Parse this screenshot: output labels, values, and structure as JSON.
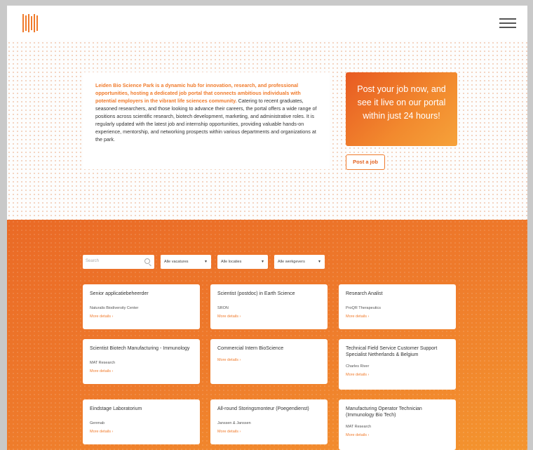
{
  "header": {
    "logo_icon": "vertical-stripes-logo-icon",
    "menu_icon": "hamburger-menu-icon"
  },
  "intro": {
    "highlight": "Leiden Bio Science Park is a dynamic hub for innovation, research, and professional opportunities, hosting a dedicated job portal that connects ambitious individuals with potential employers in the vibrant life sciences community.",
    "body": " Catering to recent graduates, seasoned researchers, and those looking to advance their careers, the portal offers a wide range of positions across scientific research, biotech development, marketing, and administrative roles. It is regularly updated with the latest job and internship opportunities, providing valuable hands-on experience, mentorship, and networking prospects within various departments and organizations at the park."
  },
  "promo": {
    "text": "Post your job now, and see it live on our portal within just 24 hours!"
  },
  "post_button": {
    "label": "Post a job"
  },
  "filters": {
    "search_placeholder": "Search",
    "search_icon": "search-icon",
    "select1": "Alle vacatures",
    "select2": "Alle locaties",
    "select3": "Alle werkgevers"
  },
  "jobs": [
    {
      "title": "Senior applicatiebeheerder",
      "company": "Naturalis Biodiversity Center",
      "more": "More details ›"
    },
    {
      "title": "Scientist (postdoc) in Earth Science",
      "company": "SRON",
      "more": "More details ›"
    },
    {
      "title": "Research Analist",
      "company": "ProQR Therapeutics",
      "more": "More details ›"
    },
    {
      "title": "Scientist Biotech Manufacturing - Immunology",
      "company": "MAT Research",
      "more": "More details ›"
    },
    {
      "title": "Commercial Intern BioScience",
      "company": "",
      "more": "More details ›"
    },
    {
      "title": "Technical Field Service Customer Support Specialist Netherlands & Belgium",
      "company": "Charles River",
      "more": "More details ›"
    },
    {
      "title": "Eindstage Laboratorium",
      "company": "Genmab",
      "more": "More details ›"
    },
    {
      "title": "All-round Storingsmonteur (Poegendienst)",
      "company": "Janssen & Janssen",
      "more": "More details ›"
    },
    {
      "title": "Manufacturing Operator Technician (Immunology Bio Tech)",
      "company": "MAT Research",
      "more": "More details ›"
    }
  ],
  "colors": {
    "accent": "#f07b2c",
    "orange_dark": "#e85a22",
    "orange_light": "#f6a23a"
  }
}
